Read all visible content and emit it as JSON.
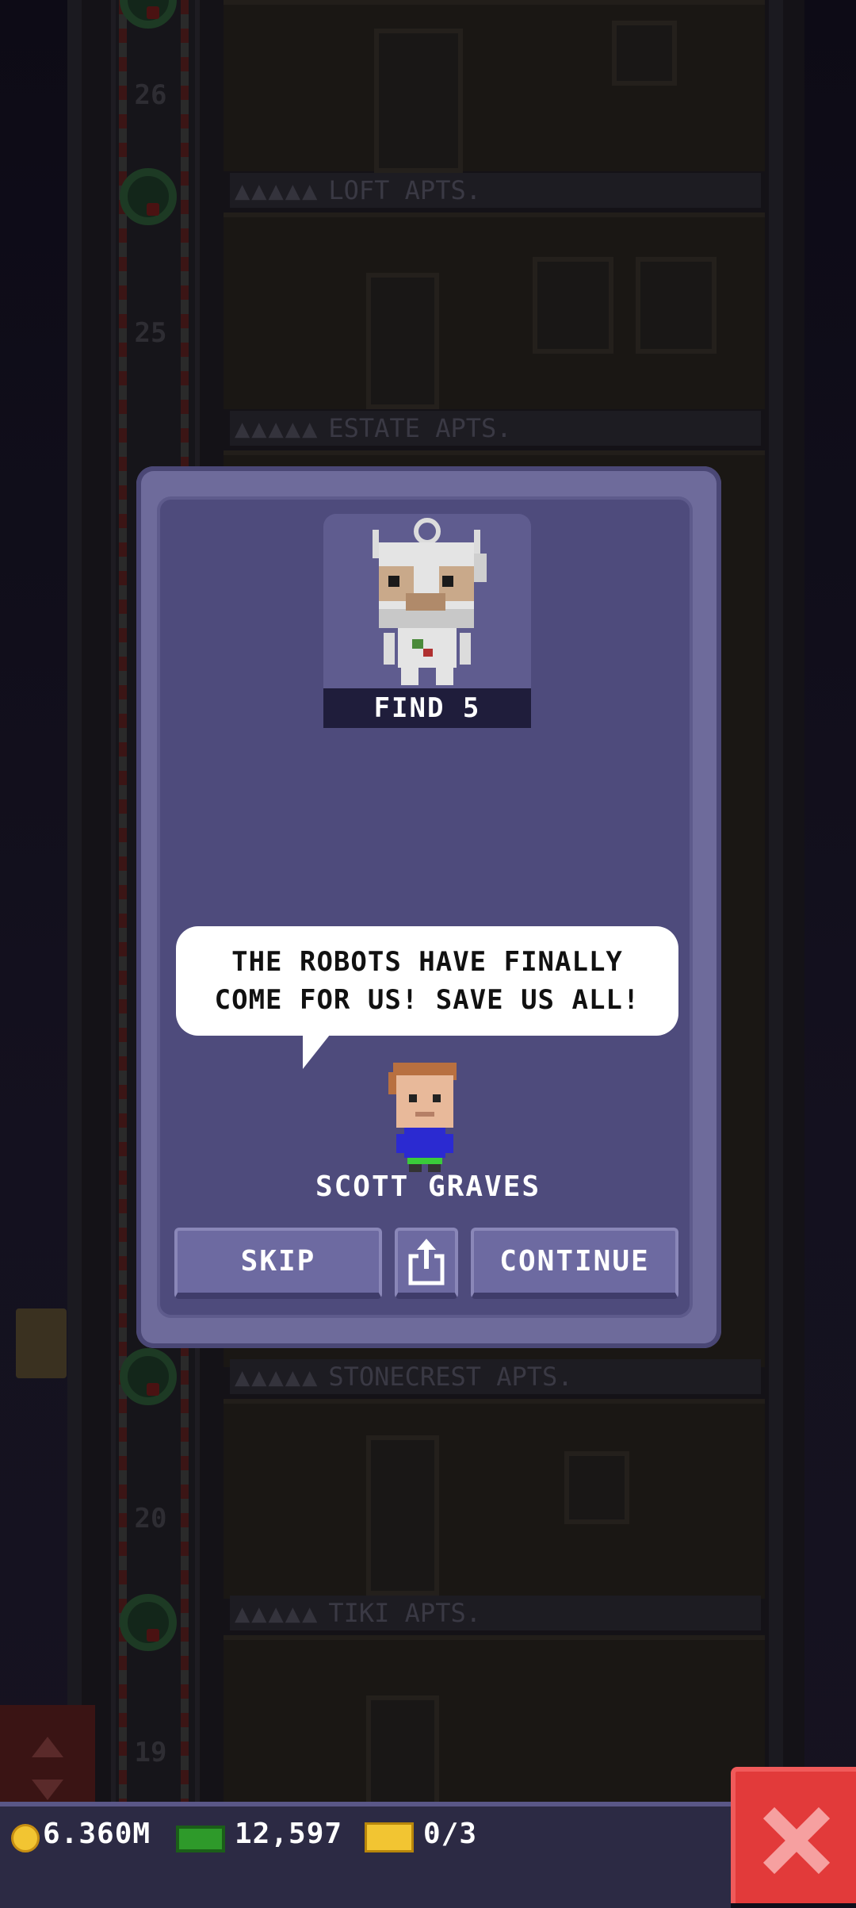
{
  "tower": {
    "floor_numbers": [
      "26",
      "25",
      "20",
      "19"
    ],
    "floor_labels": [
      {
        "dots": "▲▲▲▲▲",
        "name": "LOFT APTS."
      },
      {
        "dots": "▲▲▲▲▲",
        "name": "ESTATE APTS."
      },
      {
        "dots": "▲▲▲▲▲",
        "name": "STONECREST APTS."
      },
      {
        "dots": "▲▲▲▲▲",
        "name": "TIKI APTS."
      }
    ]
  },
  "dialog": {
    "mission_label": "FIND 5",
    "mission_icon": "robot-icon",
    "speech": "THE ROBOTS HAVE FINALLY\nCOME FOR US! SAVE US ALL!",
    "npc_name": "SCOTT GRAVES",
    "skip_label": "SKIP",
    "share_icon": "share-icon",
    "continue_label": "CONTINUE"
  },
  "status_bar": {
    "coins": "6.360M",
    "bux": "12,597",
    "tickets": "0/3"
  },
  "colors": {
    "dialog_bg": "#4e4b7c",
    "button_bg": "#6d6aa1",
    "close_button": "#e23a3a",
    "coin": "#f2c532",
    "bux": "#2e9a2a"
  }
}
